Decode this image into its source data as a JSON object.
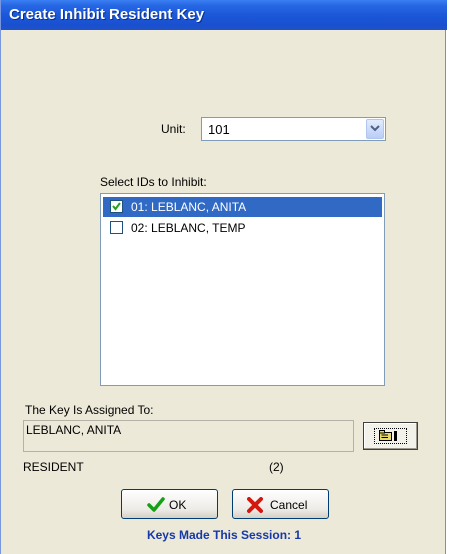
{
  "window": {
    "title": "Create Inhibit Resident Key"
  },
  "unit": {
    "label": "Unit:",
    "value": "101"
  },
  "id_list": {
    "caption": "Select IDs to Inhibit:",
    "items": [
      {
        "label": "01: LEBLANC, ANITA",
        "checked": true,
        "selected": true
      },
      {
        "label": "02: LEBLANC, TEMP",
        "checked": false,
        "selected": false
      }
    ]
  },
  "assignment": {
    "label": "The Key Is Assigned To:",
    "value": "LEBLANC, ANITA",
    "role": "RESIDENT",
    "count": "(2)"
  },
  "buttons": {
    "ok_label": "OK",
    "cancel_label": "Cancel"
  },
  "session": {
    "keys_made": "Keys Made This Session: 1"
  },
  "colors": {
    "title_bar": "#1a56d8",
    "selection": "#316ac5",
    "status_text": "#1638a8",
    "dialog_bg": "#ece9d8"
  },
  "icons": {
    "combo": "chevron-down-icon",
    "ok": "checkmark-icon",
    "cancel": "x-icon",
    "lookup": "folder-lookup-icon"
  }
}
